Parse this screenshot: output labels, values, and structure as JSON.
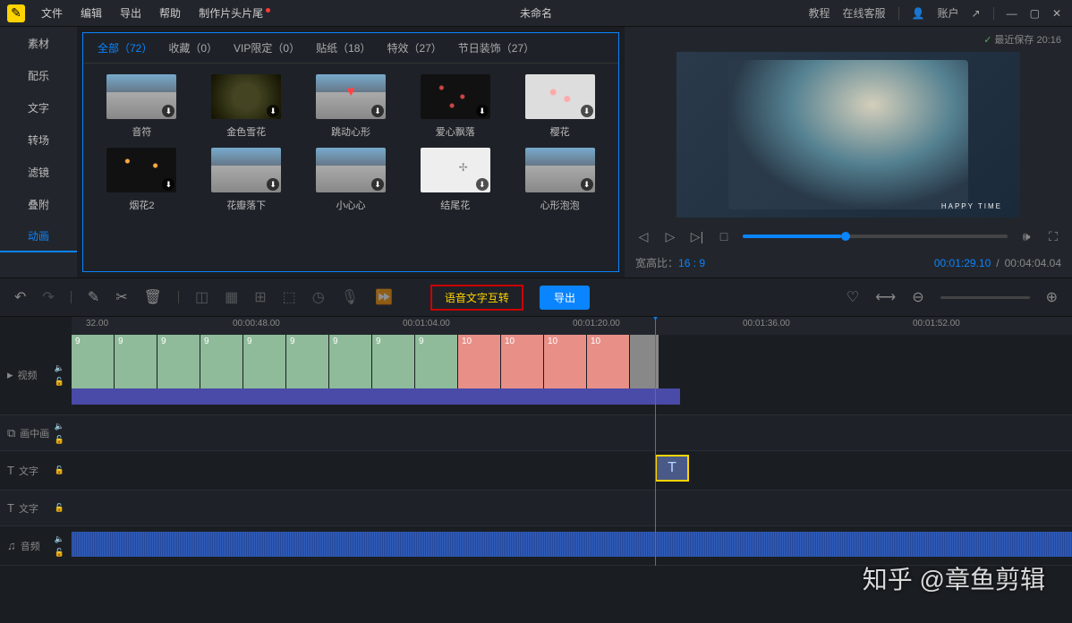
{
  "titlebar": {
    "menus": [
      "文件",
      "编辑",
      "导出",
      "帮助",
      "制作片头片尾"
    ],
    "title": "未命名",
    "right": {
      "tutorial": "教程",
      "service": "在线客服",
      "account": "账户"
    }
  },
  "save_status": "最近保存 20:16",
  "side_tabs": [
    "素材",
    "配乐",
    "文字",
    "转场",
    "滤镜",
    "叠附",
    "动画"
  ],
  "side_active": 6,
  "asset_tabs": [
    {
      "label": "全部",
      "count": 72,
      "active": true
    },
    {
      "label": "收藏",
      "count": 0
    },
    {
      "label": "VIP限定",
      "count": 0
    },
    {
      "label": "贴纸",
      "count": 18
    },
    {
      "label": "特效",
      "count": 27
    },
    {
      "label": "节日装饰",
      "count": 27
    }
  ],
  "assets": [
    {
      "name": "音符",
      "cls": "road"
    },
    {
      "name": "金色雪花",
      "cls": "dark"
    },
    {
      "name": "跳动心形",
      "cls": "heart"
    },
    {
      "name": "爱心飘落",
      "cls": "petals"
    },
    {
      "name": "樱花",
      "cls": "sakura"
    },
    {
      "name": "烟花2",
      "cls": "fire"
    },
    {
      "name": "花瓣落下",
      "cls": "road"
    },
    {
      "name": "小心心",
      "cls": "road"
    },
    {
      "name": "结尾花",
      "cls": "bird"
    },
    {
      "name": "心形泡泡",
      "cls": "road"
    }
  ],
  "preview": {
    "happy_text": "HAPPY TIME",
    "aspect_label": "宽高比：",
    "aspect": "16 : 9",
    "current": "00:01:29.10",
    "total": "00:04:04.04"
  },
  "toolbar": {
    "voice": "语音文字互转",
    "export": "导出"
  },
  "ruler": [
    "32.00",
    "00:00:48.00",
    "00:01:04.00",
    "00:01:20.00",
    "00:01:36.00",
    "00:01:52.00"
  ],
  "ruler_pos": [
    16,
    180,
    370,
    560,
    750,
    940
  ],
  "tracks": {
    "video": "视频",
    "pip": "画中画",
    "text": "文字",
    "audio": "音频"
  },
  "clips": {
    "greens": [
      "9",
      "9",
      "9",
      "9",
      "9",
      "9",
      "9",
      "9",
      "9"
    ],
    "reds": [
      "10",
      "10",
      "10",
      "10"
    ]
  },
  "watermark": "知乎 @章鱼剪辑"
}
